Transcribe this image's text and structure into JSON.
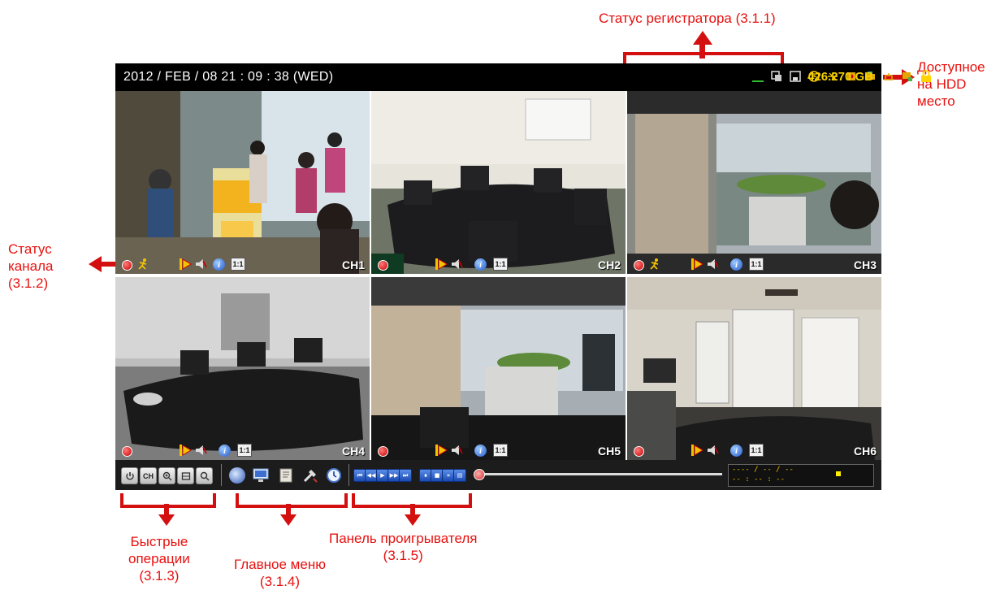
{
  "annotations": {
    "recorder_status": "Статус регистратора (3.1.1)",
    "hdd_free": [
      "Доступное",
      "на HDD",
      "место"
    ],
    "channel_status": [
      "Статус",
      "канала",
      "(3.1.2)"
    ],
    "quick_ops": [
      "Быстрые",
      "операции",
      "(3.1.3)"
    ],
    "main_menu": [
      "Главное меню",
      "(3.1.4)"
    ],
    "player_panel": [
      "Панель проигрывателя",
      "(3.1.5)"
    ]
  },
  "dvr": {
    "datetime": "2012 / FEB / 08  21 : 09 : 38 (WED)",
    "hdd_space": "426.270 GB",
    "status_icons": [
      "hdd-underline-icon",
      "copy-icon",
      "floppy-icon",
      "clock-icon",
      "network-icon",
      "key-icon",
      "usb-icon",
      "lan-icon",
      "ptz-icon",
      "lock-icon"
    ],
    "channels": [
      {
        "label": "CH1",
        "scene": "store-entrance",
        "icons": [
          "record",
          "motion",
          "play",
          "audio",
          "info",
          "ratio"
        ]
      },
      {
        "label": "CH2",
        "scene": "meeting-room",
        "icons": [
          "record",
          "play",
          "audio",
          "info",
          "ratio"
        ]
      },
      {
        "label": "CH3",
        "scene": "city-view",
        "icons": [
          "record",
          "motion",
          "play",
          "audio",
          "info",
          "ratio"
        ]
      },
      {
        "label": "CH4",
        "scene": "meeting-room-bw",
        "icons": [
          "record",
          "play",
          "audio",
          "info",
          "ratio"
        ]
      },
      {
        "label": "CH5",
        "scene": "city-view-2",
        "icons": [
          "record",
          "play",
          "audio",
          "info",
          "ratio"
        ]
      },
      {
        "label": "CH6",
        "scene": "office",
        "icons": [
          "record",
          "play",
          "audio",
          "info",
          "ratio"
        ]
      }
    ],
    "ratio_label": "1:1",
    "info_label": "i",
    "toolbar": {
      "quick_buttons": [
        "power-icon",
        "CH",
        "zoom-in-icon",
        "hdd-icon",
        "search-icon"
      ],
      "ch_label": "CH",
      "menu_buttons": [
        "disc-icon",
        "monitor-icon",
        "notes-icon",
        "tools-icon",
        "clock-icon"
      ],
      "playback_buttons": [
        "⏮",
        "◀◀",
        "▶",
        "▶▶",
        "⏭",
        "⏸",
        "■",
        "»",
        "▤"
      ],
      "date_placeholder": "---- / -- / --",
      "time_placeholder": "-- : -- : --"
    }
  },
  "colors": {
    "annotation": "#e8100e",
    "hdd_text": "#f5d100",
    "screen_bg": "#000000"
  }
}
